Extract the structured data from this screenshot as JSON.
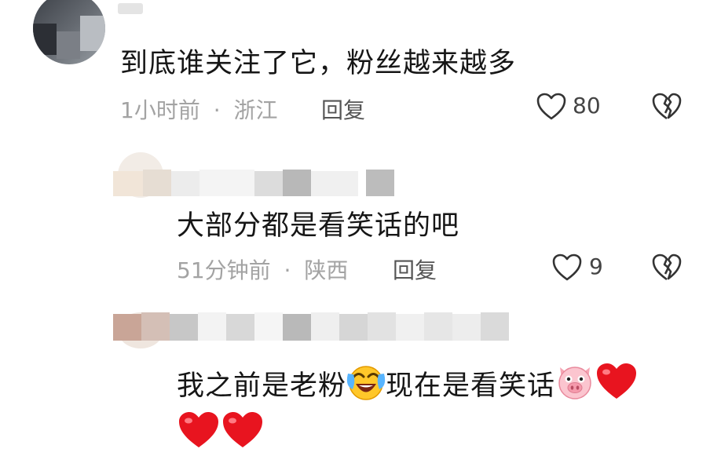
{
  "comments": [
    {
      "text": "到底谁关注了它，粉丝越来越多",
      "time": "1小时前",
      "location": "浙江",
      "reply_label": "回复",
      "likes": "80"
    },
    {
      "text": "大部分都是看笑话的吧",
      "time": "51分钟前",
      "location": "陕西",
      "reply_label": "回复",
      "likes": "9"
    },
    {
      "text_part1": "我之前是老粉",
      "text_part2": "现在是看笑话",
      "emojis": [
        "laughing-crying-emoji",
        "pig-face-emoji",
        "red-heart-emoji"
      ]
    }
  ],
  "separator": "·",
  "colors": {
    "heart_red": "#e8141f",
    "meta_gray": "#a3a3a3"
  }
}
